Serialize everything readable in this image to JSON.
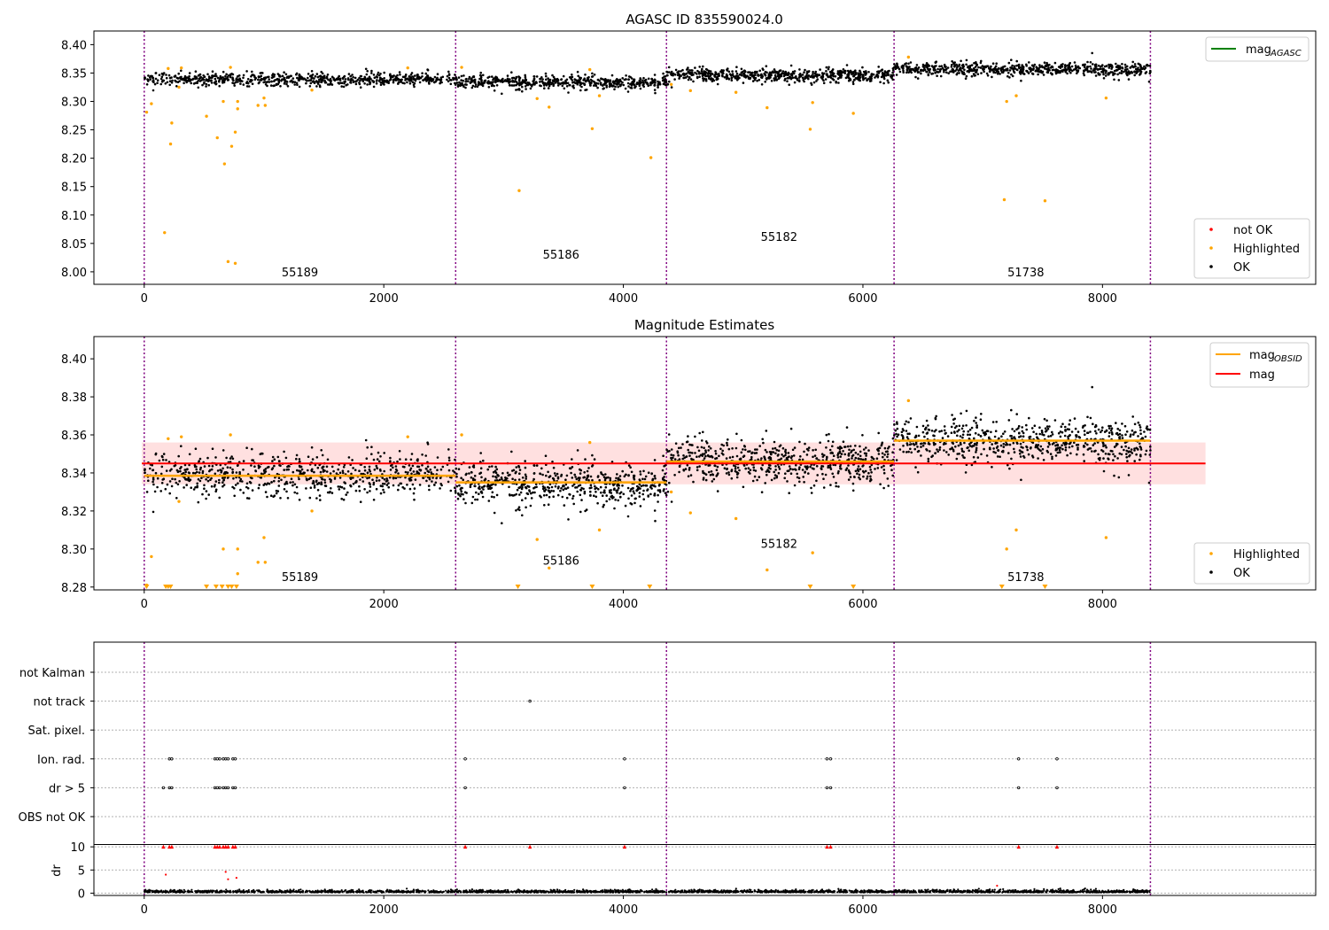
{
  "chart_data": [
    {
      "type": "scatter",
      "title": "AGASC ID 835590024.0",
      "xlim": [
        -420,
        9780
      ],
      "ylim": [
        7.978,
        8.424
      ],
      "xticks": [
        0,
        2000,
        4000,
        6000,
        8000
      ],
      "yticks": [
        8.0,
        8.05,
        8.1,
        8.15,
        8.2,
        8.25,
        8.3,
        8.35,
        8.4
      ],
      "ytick_labels": [
        "8.00",
        "8.05",
        "8.10",
        "8.15",
        "8.20",
        "8.25",
        "8.30",
        "8.35",
        "8.40"
      ],
      "obsid_boundaries": [
        0,
        2600,
        4360,
        6260,
        8400
      ],
      "obsid_labels": [
        {
          "text": "55189",
          "x": 1300,
          "y": 8.0
        },
        {
          "text": "55186",
          "x": 3480,
          "y": 8.031
        },
        {
          "text": "55182",
          "x": 5300,
          "y": 8.062
        },
        {
          "text": "51738",
          "x": 7360,
          "y": 8.0
        }
      ],
      "segments": [
        {
          "x0": 0,
          "x1": 2600,
          "mean": 8.339,
          "scatter": 0.006,
          "n": 700
        },
        {
          "x0": 2600,
          "x1": 4360,
          "mean": 8.334,
          "scatter": 0.006,
          "n": 550
        },
        {
          "x0": 4360,
          "x1": 6260,
          "mean": 8.346,
          "scatter": 0.006,
          "n": 600
        },
        {
          "x0": 6260,
          "x1": 8400,
          "mean": 8.357,
          "scatter": 0.006,
          "n": 650
        }
      ],
      "highlighted_points": [
        [
          20,
          8.281
        ],
        [
          60,
          8.296
        ],
        [
          170,
          8.069
        ],
        [
          200,
          8.358
        ],
        [
          220,
          8.225
        ],
        [
          230,
          8.262
        ],
        [
          290,
          8.325
        ],
        [
          310,
          8.359
        ],
        [
          520,
          8.274
        ],
        [
          610,
          8.236
        ],
        [
          660,
          8.3
        ],
        [
          670,
          8.19
        ],
        [
          700,
          8.018
        ],
        [
          720,
          8.36
        ],
        [
          730,
          8.221
        ],
        [
          760,
          8.246
        ],
        [
          780,
          8.287
        ],
        [
          760,
          8.015
        ],
        [
          780,
          8.3
        ],
        [
          950,
          8.293
        ],
        [
          1000,
          8.306
        ],
        [
          1010,
          8.293
        ],
        [
          1400,
          8.32
        ],
        [
          2200,
          8.359
        ],
        [
          2650,
          8.36
        ],
        [
          3130,
          8.143
        ],
        [
          3280,
          8.305
        ],
        [
          3380,
          8.29
        ],
        [
          3720,
          8.356
        ],
        [
          3740,
          8.252
        ],
        [
          3800,
          8.31
        ],
        [
          4230,
          8.201
        ],
        [
          4400,
          8.33
        ],
        [
          4560,
          8.319
        ],
        [
          4940,
          8.316
        ],
        [
          5200,
          8.289
        ],
        [
          5560,
          8.251
        ],
        [
          5580,
          8.298
        ],
        [
          5920,
          8.279
        ],
        [
          6380,
          8.378
        ],
        [
          7180,
          8.127
        ],
        [
          7200,
          8.3
        ],
        [
          7280,
          8.31
        ],
        [
          7520,
          8.125
        ],
        [
          8030,
          8.306
        ]
      ],
      "legend_lines": [
        {
          "label": "mag",
          "subscript": "AGASC",
          "color": "#008000"
        }
      ],
      "legend_points": [
        {
          "label": "not OK",
          "color": "#ff0000"
        },
        {
          "label": "Highlighted",
          "color": "#ffa500"
        },
        {
          "label": "OK",
          "color": "#000000"
        }
      ]
    },
    {
      "type": "scatter",
      "title": "Magnitude Estimates",
      "xlim": [
        -420,
        9780
      ],
      "ylim": [
        8.2785,
        8.4117
      ],
      "xticks": [
        0,
        2000,
        4000,
        6000,
        8000
      ],
      "yticks": [
        8.28,
        8.3,
        8.32,
        8.34,
        8.36,
        8.38,
        8.4
      ],
      "ytick_labels": [
        "8.28",
        "8.30",
        "8.32",
        "8.34",
        "8.36",
        "8.38",
        "8.40"
      ],
      "obsid_boundaries": [
        0,
        2600,
        4360,
        6260,
        8400
      ],
      "obsid_labels": [
        {
          "text": "55189",
          "x": 1300,
          "y": 8.2855
        },
        {
          "text": "55186",
          "x": 3480,
          "y": 8.294
        },
        {
          "text": "55182",
          "x": 5300,
          "y": 8.303
        },
        {
          "text": "51738",
          "x": 7360,
          "y": 8.2855
        }
      ],
      "mag": {
        "value": 8.345,
        "band": [
          8.334,
          8.356
        ],
        "x0": -20,
        "x1": 8860,
        "color": "#ff0000"
      },
      "mag_obsid": [
        {
          "x0": 0,
          "x1": 2600,
          "value": 8.3385
        },
        {
          "x0": 2600,
          "x1": 4360,
          "value": 8.335
        },
        {
          "x0": 4360,
          "x1": 6260,
          "value": 8.346
        },
        {
          "x0": 6260,
          "x1": 8400,
          "value": 8.357
        }
      ],
      "lower_limit_markers": [
        20,
        180,
        200,
        220,
        520,
        600,
        650,
        700,
        730,
        770,
        3120,
        3740,
        4220,
        5560,
        5920,
        7160,
        7520
      ],
      "legend_lines": [
        {
          "label": "mag",
          "subscript": "OBSID",
          "color": "#ffa500"
        },
        {
          "label": "mag",
          "subscript": "",
          "color": "#ff0000"
        }
      ],
      "legend_points": [
        {
          "label": "Highlighted",
          "color": "#ffa500"
        },
        {
          "label": "OK",
          "color": "#000000"
        }
      ]
    },
    {
      "type": "scatter",
      "xlim": [
        -420,
        9780
      ],
      "xticks": [
        0,
        2000,
        4000,
        6000,
        8000
      ],
      "flag_categories": [
        "OBS not OK",
        "dr > 5",
        "Ion. rad.",
        "Sat. pixel.",
        "not track",
        "not Kalman"
      ],
      "flags": {
        "not track": [
          3220
        ],
        "Ion. rad.": [
          210,
          230,
          590,
          610,
          630,
          660,
          680,
          700,
          740,
          760,
          2680,
          4010,
          5700,
          5730,
          7300,
          7620
        ],
        "dr > 5": [
          160,
          210,
          230,
          590,
          610,
          630,
          660,
          680,
          700,
          740,
          760,
          2680,
          4010,
          5700,
          5730,
          7300,
          7620
        ]
      },
      "dr": {
        "ylim": [
          -0.5,
          10.5
        ],
        "yticks": [
          0,
          5,
          10
        ],
        "ylabel": "dr",
        "capped_markers": [
          160,
          210,
          230,
          590,
          610,
          630,
          660,
          680,
          700,
          740,
          760,
          2680,
          3220,
          4010,
          5700,
          5730,
          7300,
          7620
        ],
        "outliers": [
          [
            180,
            4.0
          ],
          [
            680,
            4.6
          ],
          [
            700,
            3.0
          ],
          [
            770,
            3.3
          ],
          [
            7120,
            1.6
          ]
        ]
      }
    }
  ]
}
